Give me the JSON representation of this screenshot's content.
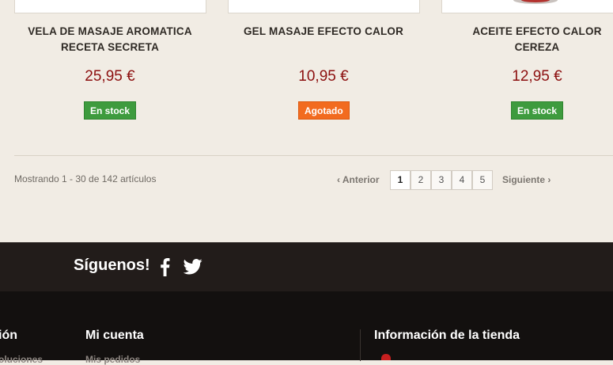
{
  "products": [
    {
      "name_line1": "VELA DE MASAJE AROMATICA",
      "name_line2": "RECETA SECRETA",
      "price": "25,95 €",
      "stock": "En stock"
    },
    {
      "name_line1": "GEL MASAJE EFECTO CALOR",
      "name_line2": "",
      "price": "10,95 €",
      "stock": "Agotado"
    },
    {
      "name_line1": "ACEITE EFECTO CALOR",
      "name_line2": "CEREZA",
      "price": "12,95 €",
      "stock": "En stock"
    }
  ],
  "pagination": {
    "showing": "Mostrando 1 - 30 de 142 artículos",
    "prev": "Anterior",
    "next": "Siguiente",
    "pages": [
      "1",
      "2",
      "3",
      "4",
      "5"
    ],
    "current": "1"
  },
  "social": {
    "follow_label": "Síguenos!",
    "icons": [
      "facebook-icon",
      "twitter-icon"
    ]
  },
  "footer": {
    "col1_heading_partial": "ión",
    "col1_link_partial": "oluciones",
    "col2_heading": "Mi cuenta",
    "col2_link": "Mis pedidos",
    "col3_heading": "Información de la tienda"
  },
  "colors": {
    "price": "#8c0f0f",
    "in_stock": "#3e9b3e",
    "out_of_stock": "#f26b1f",
    "footer_dark": "#13100f",
    "follow_bar": "#221c1a",
    "page_bg": "#f1ece4"
  }
}
